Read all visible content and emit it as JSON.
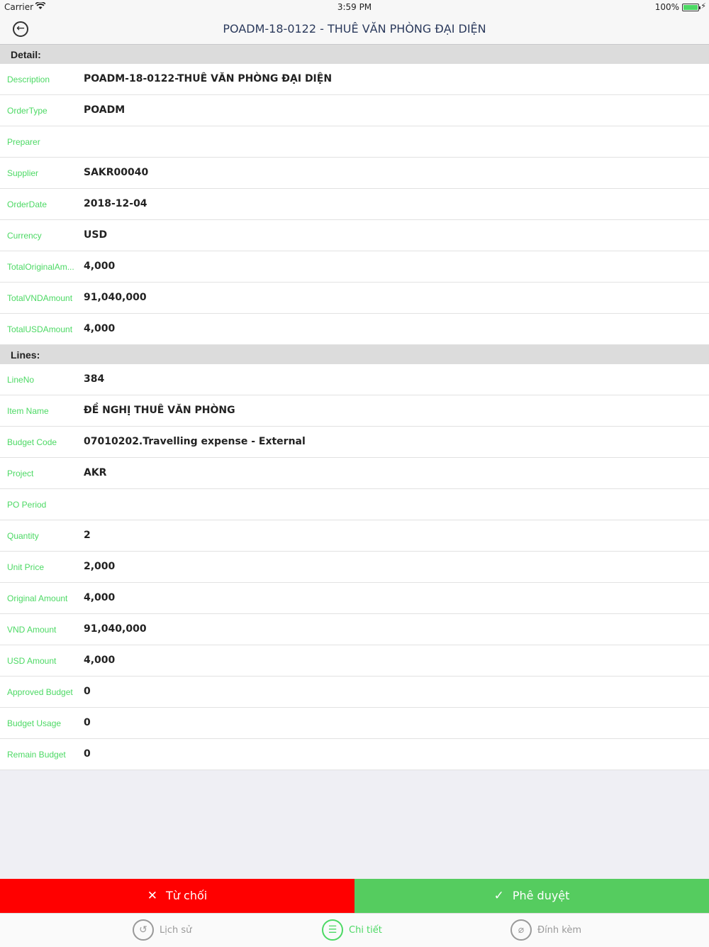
{
  "status_bar": {
    "carrier": "Carrier",
    "time": "3:59 PM",
    "battery": "100%"
  },
  "nav": {
    "title": "POADM-18-0122 - THUÊ VĂN PHÒNG ĐẠI DIỆN"
  },
  "detail": {
    "header": "Detail:",
    "rows": [
      {
        "label": "Description",
        "value": "POADM-18-0122-THUÊ VĂN PHÒNG ĐẠI DIỆN"
      },
      {
        "label": "OrderType",
        "value": "POADM"
      },
      {
        "label": "Preparer",
        "value": ""
      },
      {
        "label": "Supplier",
        "value": "SAKR00040"
      },
      {
        "label": "OrderDate",
        "value": "2018-12-04"
      },
      {
        "label": "Currency",
        "value": "USD"
      },
      {
        "label": "TotalOriginalAm...",
        "value": "4,000"
      },
      {
        "label": "TotalVNDAmount",
        "value": "91,040,000"
      },
      {
        "label": "TotalUSDAmount",
        "value": "4,000"
      }
    ]
  },
  "lines": {
    "header": "Lines:",
    "rows": [
      {
        "label": "LineNo",
        "value": "384"
      },
      {
        "label": "Item Name",
        "value": "ĐỀ NGHỊ THUÊ VĂN PHÒNG"
      },
      {
        "label": "Budget Code",
        "value": "07010202.Travelling expense - External"
      },
      {
        "label": "Project",
        "value": "AKR"
      },
      {
        "label": "PO Period",
        "value": ""
      },
      {
        "label": "Quantity",
        "value": "2"
      },
      {
        "label": "Unit Price",
        "value": "2,000"
      },
      {
        "label": "Original Amount",
        "value": "4,000"
      },
      {
        "label": "VND Amount",
        "value": "91,040,000"
      },
      {
        "label": "USD Amount",
        "value": "4,000"
      },
      {
        "label": "Approved Budget",
        "value": "0"
      },
      {
        "label": "Budget Usage",
        "value": "0"
      },
      {
        "label": "Remain Budget",
        "value": "0"
      }
    ]
  },
  "actions": {
    "reject_label": "Từ chối",
    "approve_label": "Phê duyệt"
  },
  "tabs": [
    {
      "label": "Lịch sử",
      "icon": "history-icon"
    },
    {
      "label": "Chi tiết",
      "icon": "list-icon"
    },
    {
      "label": "Đính kèm",
      "icon": "paperclip-icon"
    }
  ],
  "colors": {
    "accent": "#4cd964",
    "reject": "#ff0000",
    "approve": "#55cc5f",
    "title": "#2b3a5c"
  }
}
